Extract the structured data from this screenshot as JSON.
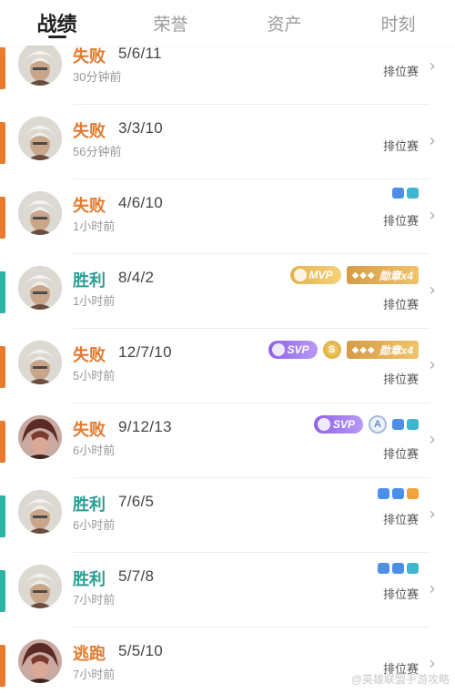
{
  "tabs": [
    {
      "label": "战绩"
    },
    {
      "label": "荣誉"
    },
    {
      "label": "资产"
    },
    {
      "label": "时刻"
    }
  ],
  "colors": {
    "loss_bar": "#ea7a2c",
    "win_bar": "#2bb3a3",
    "mvp_gold": "#e3b24b",
    "svp_purple": "#8e62e8"
  },
  "matches": [
    {
      "result": "失败",
      "kda": "5/6/11",
      "time": "30分钟前",
      "mode": "排位赛"
    },
    {
      "result": "失败",
      "kda": "3/3/10",
      "time": "56分钟前",
      "mode": "排位赛"
    },
    {
      "result": "失败",
      "kda": "4/6/10",
      "time": "1小时前",
      "mode": "排位赛"
    },
    {
      "result": "胜利",
      "kda": "8/4/2",
      "time": "1小时前",
      "mode": "排位赛",
      "mvp": "MVP",
      "medal": "勋章x4"
    },
    {
      "result": "失败",
      "kda": "12/7/10",
      "time": "5小时前",
      "mode": "排位赛",
      "svp": "SVP",
      "coin": "S",
      "medal": "勋章x4"
    },
    {
      "result": "失败",
      "kda": "9/12/13",
      "time": "6小时前",
      "mode": "排位赛",
      "svp": "SVP",
      "grade": "A"
    },
    {
      "result": "胜利",
      "kda": "7/6/5",
      "time": "6小时前",
      "mode": "排位赛"
    },
    {
      "result": "胜利",
      "kda": "5/7/8",
      "time": "7小时前",
      "mode": "排位赛"
    },
    {
      "result": "逃跑",
      "kda": "5/5/10",
      "time": "7小时前",
      "mode": "排位赛"
    }
  ],
  "watermark": "@英雄联盟手游攻略"
}
